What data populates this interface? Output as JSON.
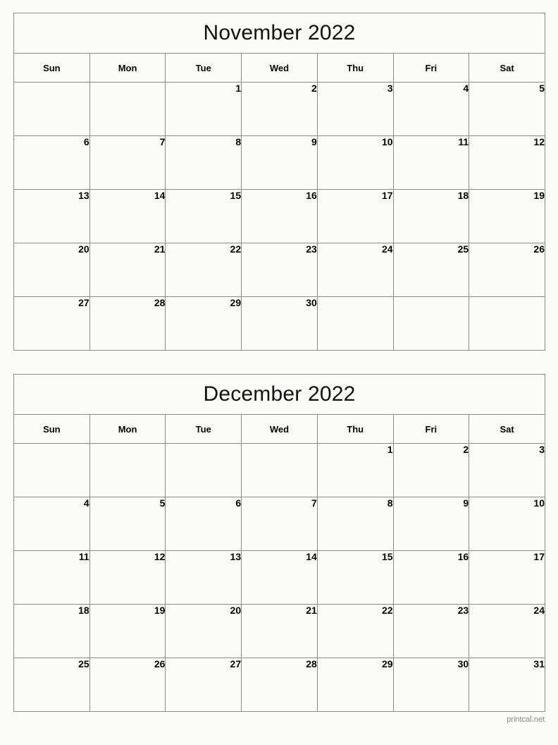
{
  "footer": {
    "credit": "printcal.net"
  },
  "weekdays": [
    "Sun",
    "Mon",
    "Tue",
    "Wed",
    "Thu",
    "Fri",
    "Sat"
  ],
  "colors": {
    "background": "#fbfcfa",
    "border": "#8c8c8c",
    "text": "#000000",
    "footer_text": "#8a8a8a"
  },
  "months": [
    {
      "title": "November 2022",
      "name": "November",
      "year": "2022",
      "weeks": [
        [
          "",
          "",
          "1",
          "2",
          "3",
          "4",
          "5"
        ],
        [
          "6",
          "7",
          "8",
          "9",
          "10",
          "11",
          "12"
        ],
        [
          "13",
          "14",
          "15",
          "16",
          "17",
          "18",
          "19"
        ],
        [
          "20",
          "21",
          "22",
          "23",
          "24",
          "25",
          "26"
        ],
        [
          "27",
          "28",
          "29",
          "30",
          "",
          "",
          ""
        ]
      ]
    },
    {
      "title": "December 2022",
      "name": "December",
      "year": "2022",
      "weeks": [
        [
          "",
          "",
          "",
          "",
          "1",
          "2",
          "3"
        ],
        [
          "4",
          "5",
          "6",
          "7",
          "8",
          "9",
          "10"
        ],
        [
          "11",
          "12",
          "13",
          "14",
          "15",
          "16",
          "17"
        ],
        [
          "18",
          "19",
          "20",
          "21",
          "22",
          "23",
          "24"
        ],
        [
          "25",
          "26",
          "27",
          "28",
          "29",
          "30",
          "31"
        ]
      ]
    }
  ]
}
